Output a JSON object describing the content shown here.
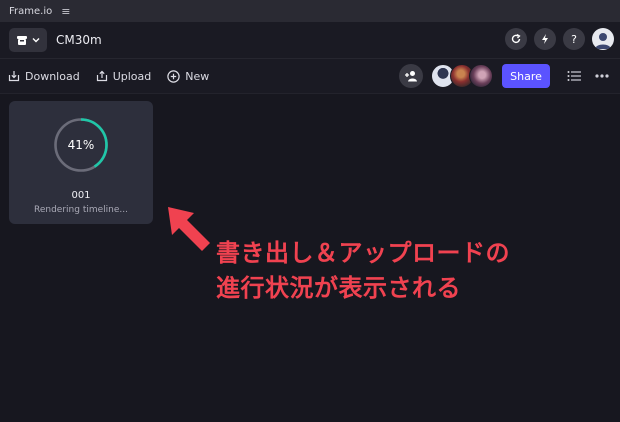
{
  "app": {
    "title": "Frame.io",
    "menu_glyph": "≡"
  },
  "header": {
    "project_name": "CM30m",
    "help_glyph": "?"
  },
  "toolbar": {
    "download_label": "Download",
    "upload_label": "Upload",
    "new_label": "New",
    "share_label": "Share"
  },
  "asset": {
    "name": "001",
    "status": "Rendering timeline...",
    "progress_label": "41%",
    "progress": 0.41
  },
  "annotation": {
    "line1": "書き出し＆アップロードの",
    "line2": "進行状況が表示される"
  },
  "colors": {
    "accent": "#5b53ff",
    "progress": "#1fc7a8",
    "annotation": "#f04250"
  }
}
